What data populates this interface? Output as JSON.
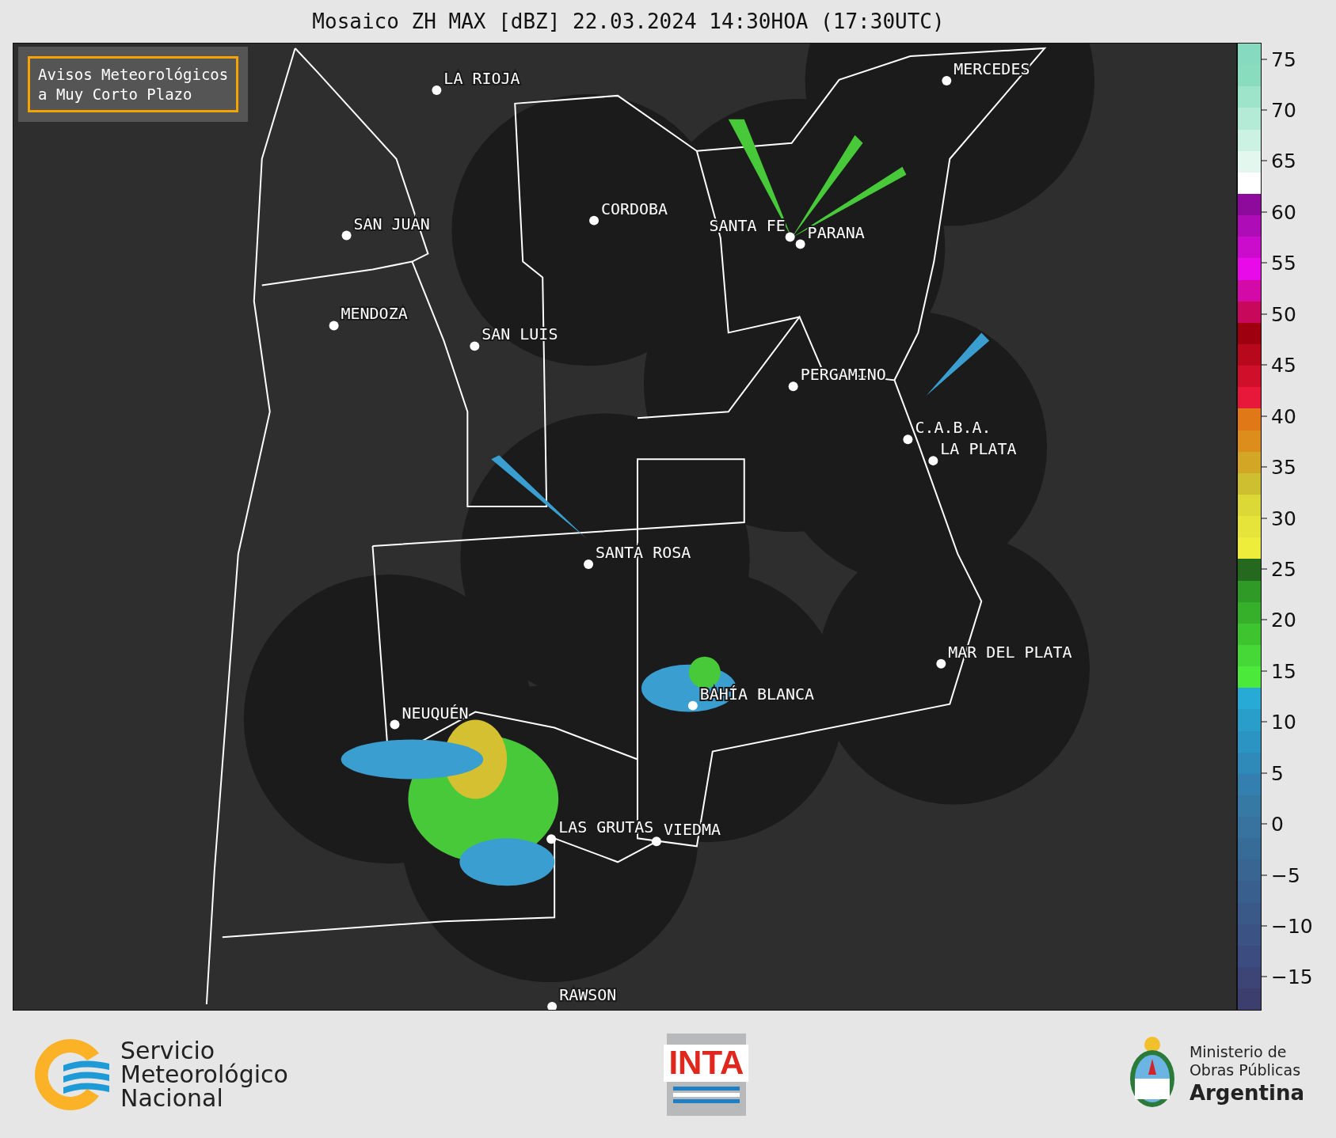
{
  "title": "Mosaico ZH MAX [dBZ] 22.03.2024 14:30HOA (17:30UTC)",
  "warning_box": {
    "lines": [
      "Avisos Meteorológicos",
      "a Muy Corto Plazo"
    ]
  },
  "cities": [
    {
      "name": "LA RIOJA"
    },
    {
      "name": "SAN JUAN"
    },
    {
      "name": "CORDOBA"
    },
    {
      "name": "SANTA FE"
    },
    {
      "name": "PARANA"
    },
    {
      "name": "MENDOZA"
    },
    {
      "name": "SAN LUIS"
    },
    {
      "name": "MERCEDES"
    },
    {
      "name": "PERGAMINO"
    },
    {
      "name": "C.A.B.A."
    },
    {
      "name": "LA PLATA"
    },
    {
      "name": "SANTA ROSA"
    },
    {
      "name": "MAR DEL PLATA"
    },
    {
      "name": "BAHÍA BLANCA"
    },
    {
      "name": "NEUQUÉN"
    },
    {
      "name": "LAS GRUTAS"
    },
    {
      "name": "VIEDMA"
    },
    {
      "name": "RAWSON"
    }
  ],
  "colorbar": {
    "ticks": [
      "75",
      "70",
      "65",
      "60",
      "55",
      "50",
      "45",
      "40",
      "35",
      "30",
      "25",
      "20",
      "15",
      "10",
      "5",
      "0",
      "−5",
      "−10",
      "−15"
    ],
    "bins": [
      {
        "color": "#86dac0"
      },
      {
        "color": "#8adcbf"
      },
      {
        "color": "#9de4cb"
      },
      {
        "color": "#b3ebd6"
      },
      {
        "color": "#ccf2e3"
      },
      {
        "color": "#e3f7ef"
      },
      {
        "color": "#ffffff"
      },
      {
        "color": "#8e0a9c"
      },
      {
        "color": "#ad0cb6"
      },
      {
        "color": "#cc0ccc"
      },
      {
        "color": "#e80ae8"
      },
      {
        "color": "#d40aa8"
      },
      {
        "color": "#c8085a"
      },
      {
        "color": "#9e0010"
      },
      {
        "color": "#b8081c"
      },
      {
        "color": "#d0102a"
      },
      {
        "color": "#e8183a"
      },
      {
        "color": "#e07818"
      },
      {
        "color": "#dd8d1c"
      },
      {
        "color": "#d4a625"
      },
      {
        "color": "#cdbf2f"
      },
      {
        "color": "#dcd836"
      },
      {
        "color": "#e6e43a"
      },
      {
        "color": "#efed3c"
      },
      {
        "color": "#24691e"
      },
      {
        "color": "#2f9b26"
      },
      {
        "color": "#36b02a"
      },
      {
        "color": "#3ec42f"
      },
      {
        "color": "#45d836"
      },
      {
        "color": "#4bea3a"
      },
      {
        "color": "#27aad6"
      },
      {
        "color": "#299ecb"
      },
      {
        "color": "#2b94c2"
      },
      {
        "color": "#2f8ab9"
      },
      {
        "color": "#3380b0"
      },
      {
        "color": "#3679a5"
      },
      {
        "color": "#37739e"
      },
      {
        "color": "#376c98"
      },
      {
        "color": "#386592"
      },
      {
        "color": "#395f8e"
      },
      {
        "color": "#3a5888"
      },
      {
        "color": "#3b5285"
      },
      {
        "color": "#3c4b80"
      },
      {
        "color": "#3d4577"
      },
      {
        "color": "#3c3f6e"
      }
    ]
  },
  "footer": {
    "smn": [
      "Servicio",
      "Meteorológico",
      "Nacional"
    ],
    "inta": "INTA",
    "ministry": [
      "Ministerio de",
      "Obras Públicas",
      "Argentina"
    ]
  }
}
